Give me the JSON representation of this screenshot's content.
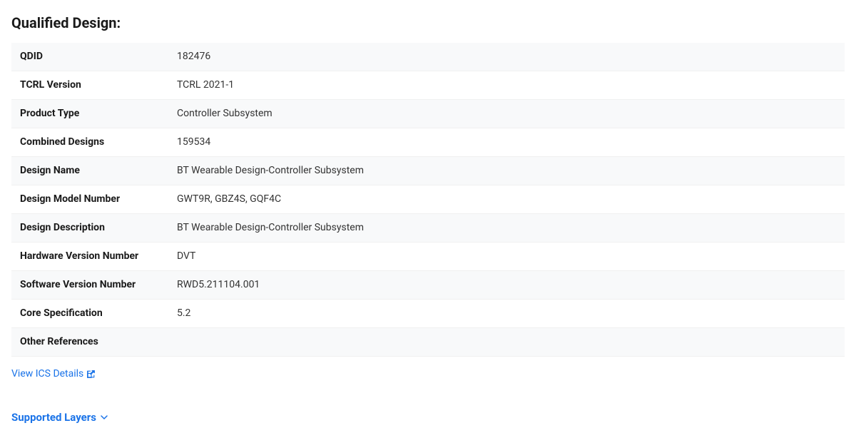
{
  "page": {
    "title": "Qualified Design:"
  },
  "table": {
    "rows": [
      {
        "label": "QDID",
        "value": "182476"
      },
      {
        "label": "TCRL Version",
        "value": "TCRL 2021-1"
      },
      {
        "label": "Product Type",
        "value": "Controller Subsystem"
      },
      {
        "label": "Combined Designs",
        "value": "159534"
      },
      {
        "label": "Design Name",
        "value": "BT Wearable Design-Controller Subsystem"
      },
      {
        "label": "Design Model Number",
        "value": "GWT9R, GBZ4S, GQF4C"
      },
      {
        "label": "Design Description",
        "value": "BT Wearable Design-Controller Subsystem"
      },
      {
        "label": "Hardware Version Number",
        "value": "DVT"
      },
      {
        "label": "Software Version Number",
        "value": "RWD5.211104.001"
      },
      {
        "label": "Core Specification",
        "value": "5.2"
      },
      {
        "label": "Other References",
        "value": ""
      }
    ]
  },
  "links": {
    "view_ics": "View ICS Details"
  },
  "supported_layers": {
    "label": "Supported Layers"
  }
}
